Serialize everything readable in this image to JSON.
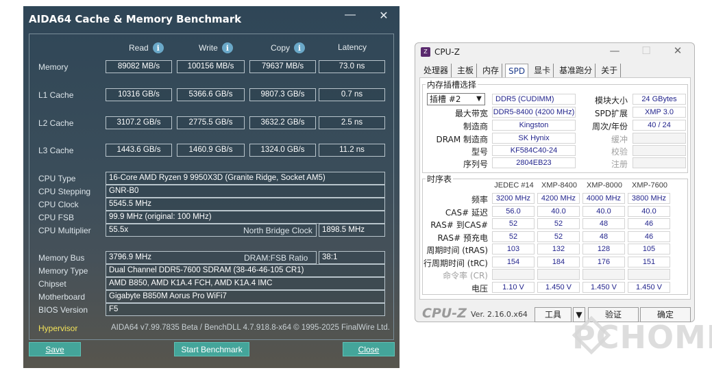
{
  "aida": {
    "title": "AIDA64 Cache & Memory Benchmark",
    "minimize": "—",
    "close": "✕",
    "headers": {
      "read": "Read",
      "write": "Write",
      "copy": "Copy",
      "latency": "Latency"
    },
    "rows": [
      {
        "label": "Memory",
        "read": "89082 MB/s",
        "write": "100156 MB/s",
        "copy": "79637 MB/s",
        "latency": "73.0 ns"
      },
      {
        "label": "L1 Cache",
        "read": "10316 GB/s",
        "write": "5366.6 GB/s",
        "copy": "9807.3 GB/s",
        "latency": "0.7 ns"
      },
      {
        "label": "L2 Cache",
        "read": "3107.2 GB/s",
        "write": "2775.5 GB/s",
        "copy": "3632.2 GB/s",
        "latency": "2.5 ns"
      },
      {
        "label": "L3 Cache",
        "read": "1443.6 GB/s",
        "write": "1460.9 GB/s",
        "copy": "1324.0 GB/s",
        "latency": "11.2 ns"
      }
    ],
    "info": {
      "cpu_type_label": "CPU Type",
      "cpu_type": "16-Core AMD Ryzen 9 9950X3D  (Granite Ridge, Socket AM5)",
      "cpu_stepping_label": "CPU Stepping",
      "cpu_stepping": "GNR-B0",
      "cpu_clock_label": "CPU Clock",
      "cpu_clock": "5545.5 MHz",
      "cpu_fsb_label": "CPU FSB",
      "cpu_fsb": "99.9 MHz  (original: 100 MHz)",
      "cpu_multiplier_label": "CPU Multiplier",
      "cpu_multiplier": "55.5x",
      "nb_clock_label": "North Bridge Clock",
      "nb_clock": "1898.5 MHz",
      "memory_bus_label": "Memory Bus",
      "memory_bus": "3796.9 MHz",
      "dram_fsb_label": "DRAM:FSB Ratio",
      "dram_fsb": "38:1",
      "memory_type_label": "Memory Type",
      "memory_type": "Dual Channel DDR5-7600 SDRAM  (38-46-46-105 CR1)",
      "chipset_label": "Chipset",
      "chipset": "AMD B850, AMD K1A.4 FCH, AMD K1A.4 IMC",
      "motherboard_label": "Motherboard",
      "motherboard": "Gigabyte B850M Aorus Pro WiFi7",
      "bios_label": "BIOS Version",
      "bios": "F5"
    },
    "hypervisor": "Hypervisor",
    "footer": "AIDA64 v7.99.7835 Beta / BenchDLL 4.7.918.8-x64 © 1995-2025 FinalWire Ltd.",
    "buttons": {
      "save": "Save",
      "start": "Start Benchmark",
      "close": "Close"
    }
  },
  "cpuz": {
    "title": "CPU-Z",
    "logo": "Z",
    "tabs": [
      "处理器",
      "主板",
      "内存",
      "SPD",
      "显卡",
      "基准跑分",
      "关于"
    ],
    "active_tab": "SPD",
    "slot_group": "内存插槽选择",
    "slot_select": "插槽 #2",
    "module": {
      "type": "DDR5 (CUDIMM)",
      "size_label": "模块大小",
      "size": "24 GBytes",
      "bandwidth_label": "最大带宽",
      "bandwidth": "DDR5-8400 (4200 MHz)",
      "spd_ext_label": "SPD扩展",
      "spd_ext": "XMP 3.0",
      "maker_label": "制造商",
      "maker": "Kingston",
      "week_year_label": "周次/年份",
      "week_year": "40 / 24",
      "dram_maker_label": "DRAM 制造商",
      "dram_maker": "SK Hynix",
      "buffer_label": "缓冲",
      "model_label": "型号",
      "model": "KF584C40-24",
      "checksum_label": "校验",
      "serial_label": "序列号",
      "serial": "2804EB23",
      "registered_label": "注册"
    },
    "timing_group": "时序表",
    "timing_headers": [
      "JEDEC #14",
      "XMP-8400",
      "XMP-8000",
      "XMP-7600"
    ],
    "timing_rows": [
      {
        "label": "频率",
        "values": [
          "3200 MHz",
          "4200 MHz",
          "4000 MHz",
          "3800 MHz"
        ]
      },
      {
        "label": "CAS# 延迟",
        "values": [
          "56.0",
          "40.0",
          "40.0",
          "40.0"
        ]
      },
      {
        "label": "RAS# 到CAS#",
        "values": [
          "52",
          "52",
          "48",
          "46"
        ]
      },
      {
        "label": "RAS# 预充电",
        "values": [
          "52",
          "52",
          "48",
          "46"
        ]
      },
      {
        "label": "周期时间 (tRAS)",
        "values": [
          "103",
          "132",
          "128",
          "105"
        ]
      },
      {
        "label": "行周期时间 (tRC)",
        "values": [
          "154",
          "184",
          "176",
          "151"
        ]
      },
      {
        "label": "命令率 (CR)",
        "values": [
          "",
          "",
          "",
          ""
        ]
      },
      {
        "label": "电压",
        "values": [
          "1.10 V",
          "1.450 V",
          "1.450 V",
          "1.450 V"
        ]
      }
    ],
    "brand": "CPU-Z",
    "version": "Ver. 2.16.0.x64",
    "tools": "工具",
    "validate": "验证",
    "ok": "确定"
  },
  "watermark": "PCHOME"
}
